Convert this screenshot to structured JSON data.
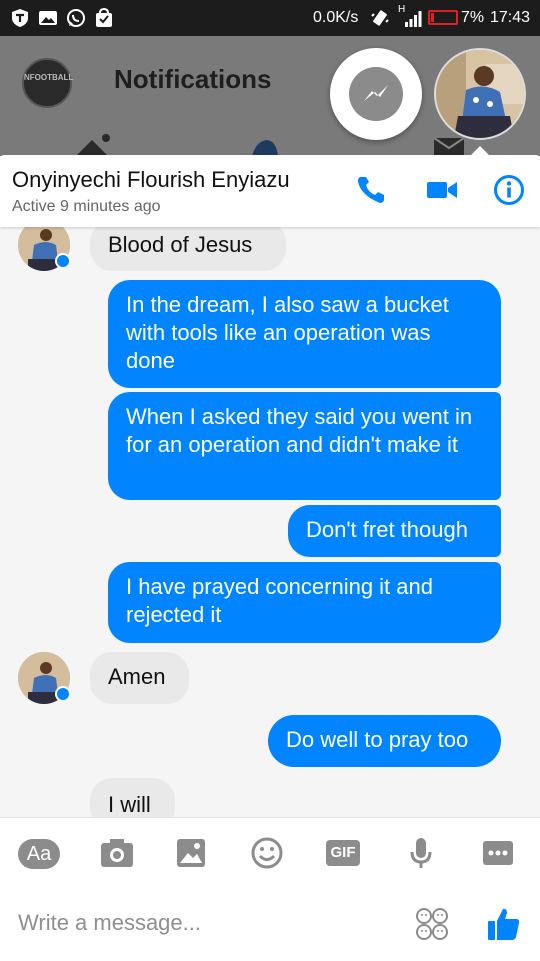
{
  "status_bar": {
    "speed": "0.0K/s",
    "network": "H",
    "battery": "7%",
    "time": "17:43",
    "left_icons": [
      "shield-icon",
      "image-icon",
      "whatsapp-icon",
      "bag-icon"
    ]
  },
  "background_app": {
    "title": "Notifications",
    "logo_text": "NFOOTBALL"
  },
  "chat_header": {
    "name": "Onyinyechi Flourish Enyiazu",
    "status": "Active 9 minutes ago",
    "actions": [
      "phone-icon",
      "video-icon",
      "info-icon"
    ]
  },
  "messages": [
    {
      "from": "them",
      "text": "Blood of Jesus"
    },
    {
      "from": "me",
      "text": "In the dream, I also saw a bucket with tools like an operation was done"
    },
    {
      "from": "me",
      "text": "When I asked they said you went in for an operation and didn't make it"
    },
    {
      "from": "me",
      "text": "Don't fret though"
    },
    {
      "from": "me",
      "text": "I have prayed concerning it and rejected it"
    },
    {
      "from": "them",
      "text": "Amen"
    },
    {
      "from": "me",
      "text": "Do well to pray too"
    },
    {
      "from": "them",
      "text": "I will"
    }
  ],
  "composer": {
    "aa_label": "Aa",
    "gif_label": "GIF",
    "placeholder": "Write a message..."
  },
  "colors": {
    "accent": "#0084ff",
    "incoming_bubble": "#e9e9e9",
    "chat_bg": "#f5f5f5",
    "icon_gray": "#8c8c8c"
  }
}
